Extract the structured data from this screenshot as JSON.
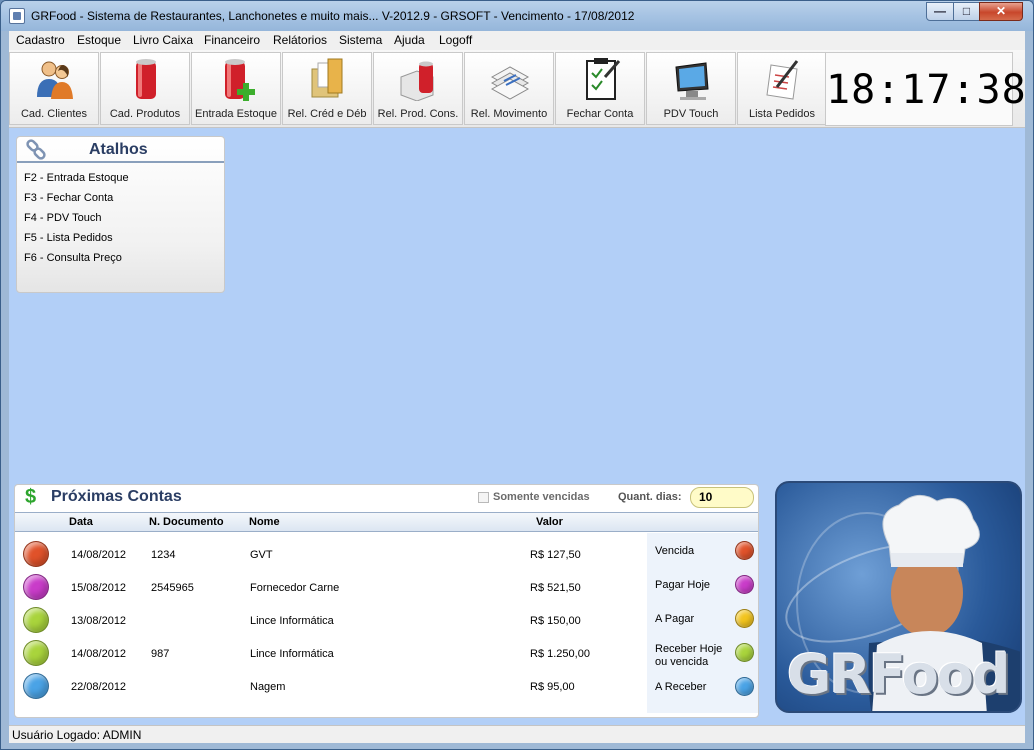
{
  "window": {
    "title": "GRFood - Sistema de Restaurantes, Lanchonetes e muito mais... V-2012.9 - GRSOFT - Vencimento - 17/08/2012",
    "minimize": "—",
    "maximize": "□",
    "close": "✕"
  },
  "menu": [
    "Cadastro",
    "Estoque",
    "Livro Caixa",
    "Financeiro",
    "Relátorios",
    "Sistema",
    "Ajuda",
    "Logoff"
  ],
  "toolbar": [
    {
      "label": "Cad. Clientes",
      "icon": "people-icon"
    },
    {
      "label": "Cad. Produtos",
      "icon": "can-icon"
    },
    {
      "label": "Entrada Estoque",
      "icon": "can-plus-icon"
    },
    {
      "label": "Rel. Créd e Déb",
      "icon": "folder-icon"
    },
    {
      "label": "Rel. Prod. Cons.",
      "icon": "box-can-icon"
    },
    {
      "label": "Rel. Movimento",
      "icon": "papers-icon"
    },
    {
      "label": "Fechar Conta",
      "icon": "clipboard-icon"
    },
    {
      "label": "PDV Touch",
      "icon": "monitor-icon"
    },
    {
      "label": "Lista Pedidos",
      "icon": "list-pen-icon"
    }
  ],
  "clock": "18:17:38",
  "atalhos": {
    "title": "Atalhos",
    "items": [
      "F2 - Entrada Estoque",
      "F3 - Fechar Conta",
      "F4 - PDV Touch",
      "F5 - Lista Pedidos",
      "F6 - Consulta Preço"
    ]
  },
  "contas": {
    "title": "Próximas Contas",
    "somente_vencidas_label": "Somente vencidas",
    "somente_vencidas_checked": false,
    "quant_label": "Quant. dias:",
    "quant_value": "10",
    "headers": {
      "data": "Data",
      "documento": "N. Documento",
      "nome": "Nome",
      "valor": "Valor"
    },
    "rows": [
      {
        "color": "#e0522a",
        "data": "14/08/2012",
        "documento": "1234",
        "nome": "GVT",
        "valor": "R$ 127,50"
      },
      {
        "color": "#c93cc9",
        "data": "15/08/2012",
        "documento": "2545965",
        "nome": "Fornecedor Carne",
        "valor": "R$ 521,50"
      },
      {
        "color": "#a9d43c",
        "data": "13/08/2012",
        "documento": "",
        "nome": "Lince Informática",
        "valor": "R$ 150,00"
      },
      {
        "color": "#a9d43c",
        "data": "14/08/2012",
        "documento": "987",
        "nome": "Lince Informática",
        "valor": "R$ 1.250,00"
      },
      {
        "color": "#4aa3e6",
        "data": "22/08/2012",
        "documento": "",
        "nome": "Nagem",
        "valor": "R$ 95,00"
      }
    ],
    "legend": [
      {
        "label": "Vencida",
        "color": "#e0522a"
      },
      {
        "label": "Pagar Hoje",
        "color": "#c93cc9"
      },
      {
        "label": "A Pagar",
        "color": "#f2c41e"
      },
      {
        "label": "Receber Hoje ou vencida",
        "color": "#a9d43c"
      },
      {
        "label": "A Receber",
        "color": "#4aa3e6"
      }
    ]
  },
  "logo_text": "GRFood",
  "status": "Usuário Logado: ADMIN"
}
